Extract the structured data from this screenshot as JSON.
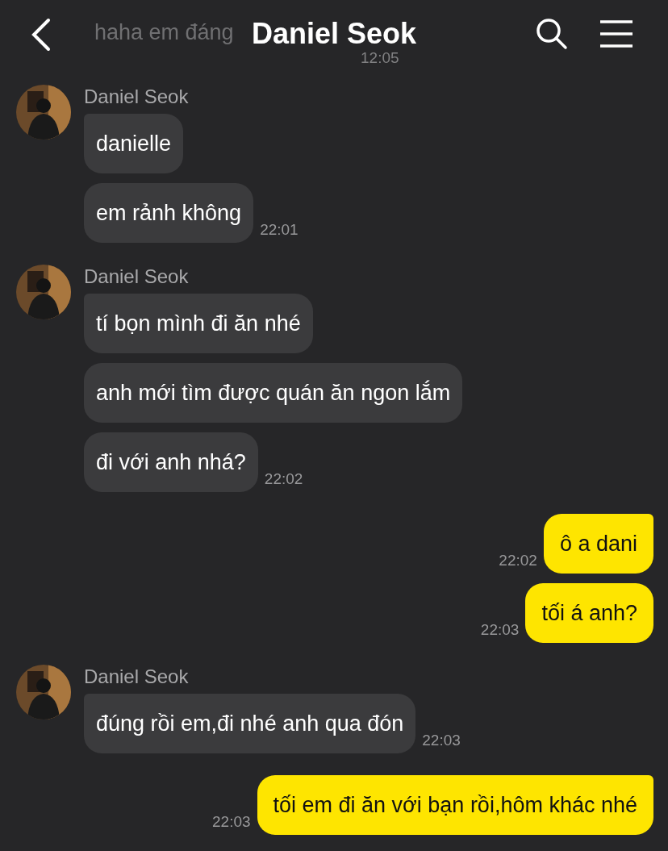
{
  "header": {
    "title": "Daniel Seok"
  },
  "faded_message": {
    "text": "haha em đáng",
    "time": "12:05"
  },
  "groups": [
    {
      "kind": "incoming",
      "sender": "Daniel Seok",
      "bubbles": [
        {
          "text": "danielle"
        },
        {
          "text": "em rảnh không",
          "time": "22:01"
        }
      ]
    },
    {
      "kind": "incoming",
      "sender": "Daniel Seok",
      "bubbles": [
        {
          "text": "tí bọn mình đi ăn nhé"
        },
        {
          "text": "anh mới tìm được quán ăn ngon lắm"
        },
        {
          "text": "đi với anh nhá?",
          "time": "22:02"
        }
      ]
    },
    {
      "kind": "outgoing",
      "bubbles": [
        {
          "text": "ô a dani",
          "time": "22:02"
        },
        {
          "text": "tối á anh?",
          "time": "22:03"
        }
      ]
    },
    {
      "kind": "incoming",
      "sender": "Daniel Seok",
      "bubbles": [
        {
          "text": "đúng rồi em,đi nhé anh qua đón",
          "time": "22:03"
        }
      ]
    },
    {
      "kind": "outgoing",
      "bubbles": [
        {
          "text": "tối em đi ăn với bạn rồi,hôm khác nhé",
          "time": "22:03"
        }
      ]
    }
  ]
}
